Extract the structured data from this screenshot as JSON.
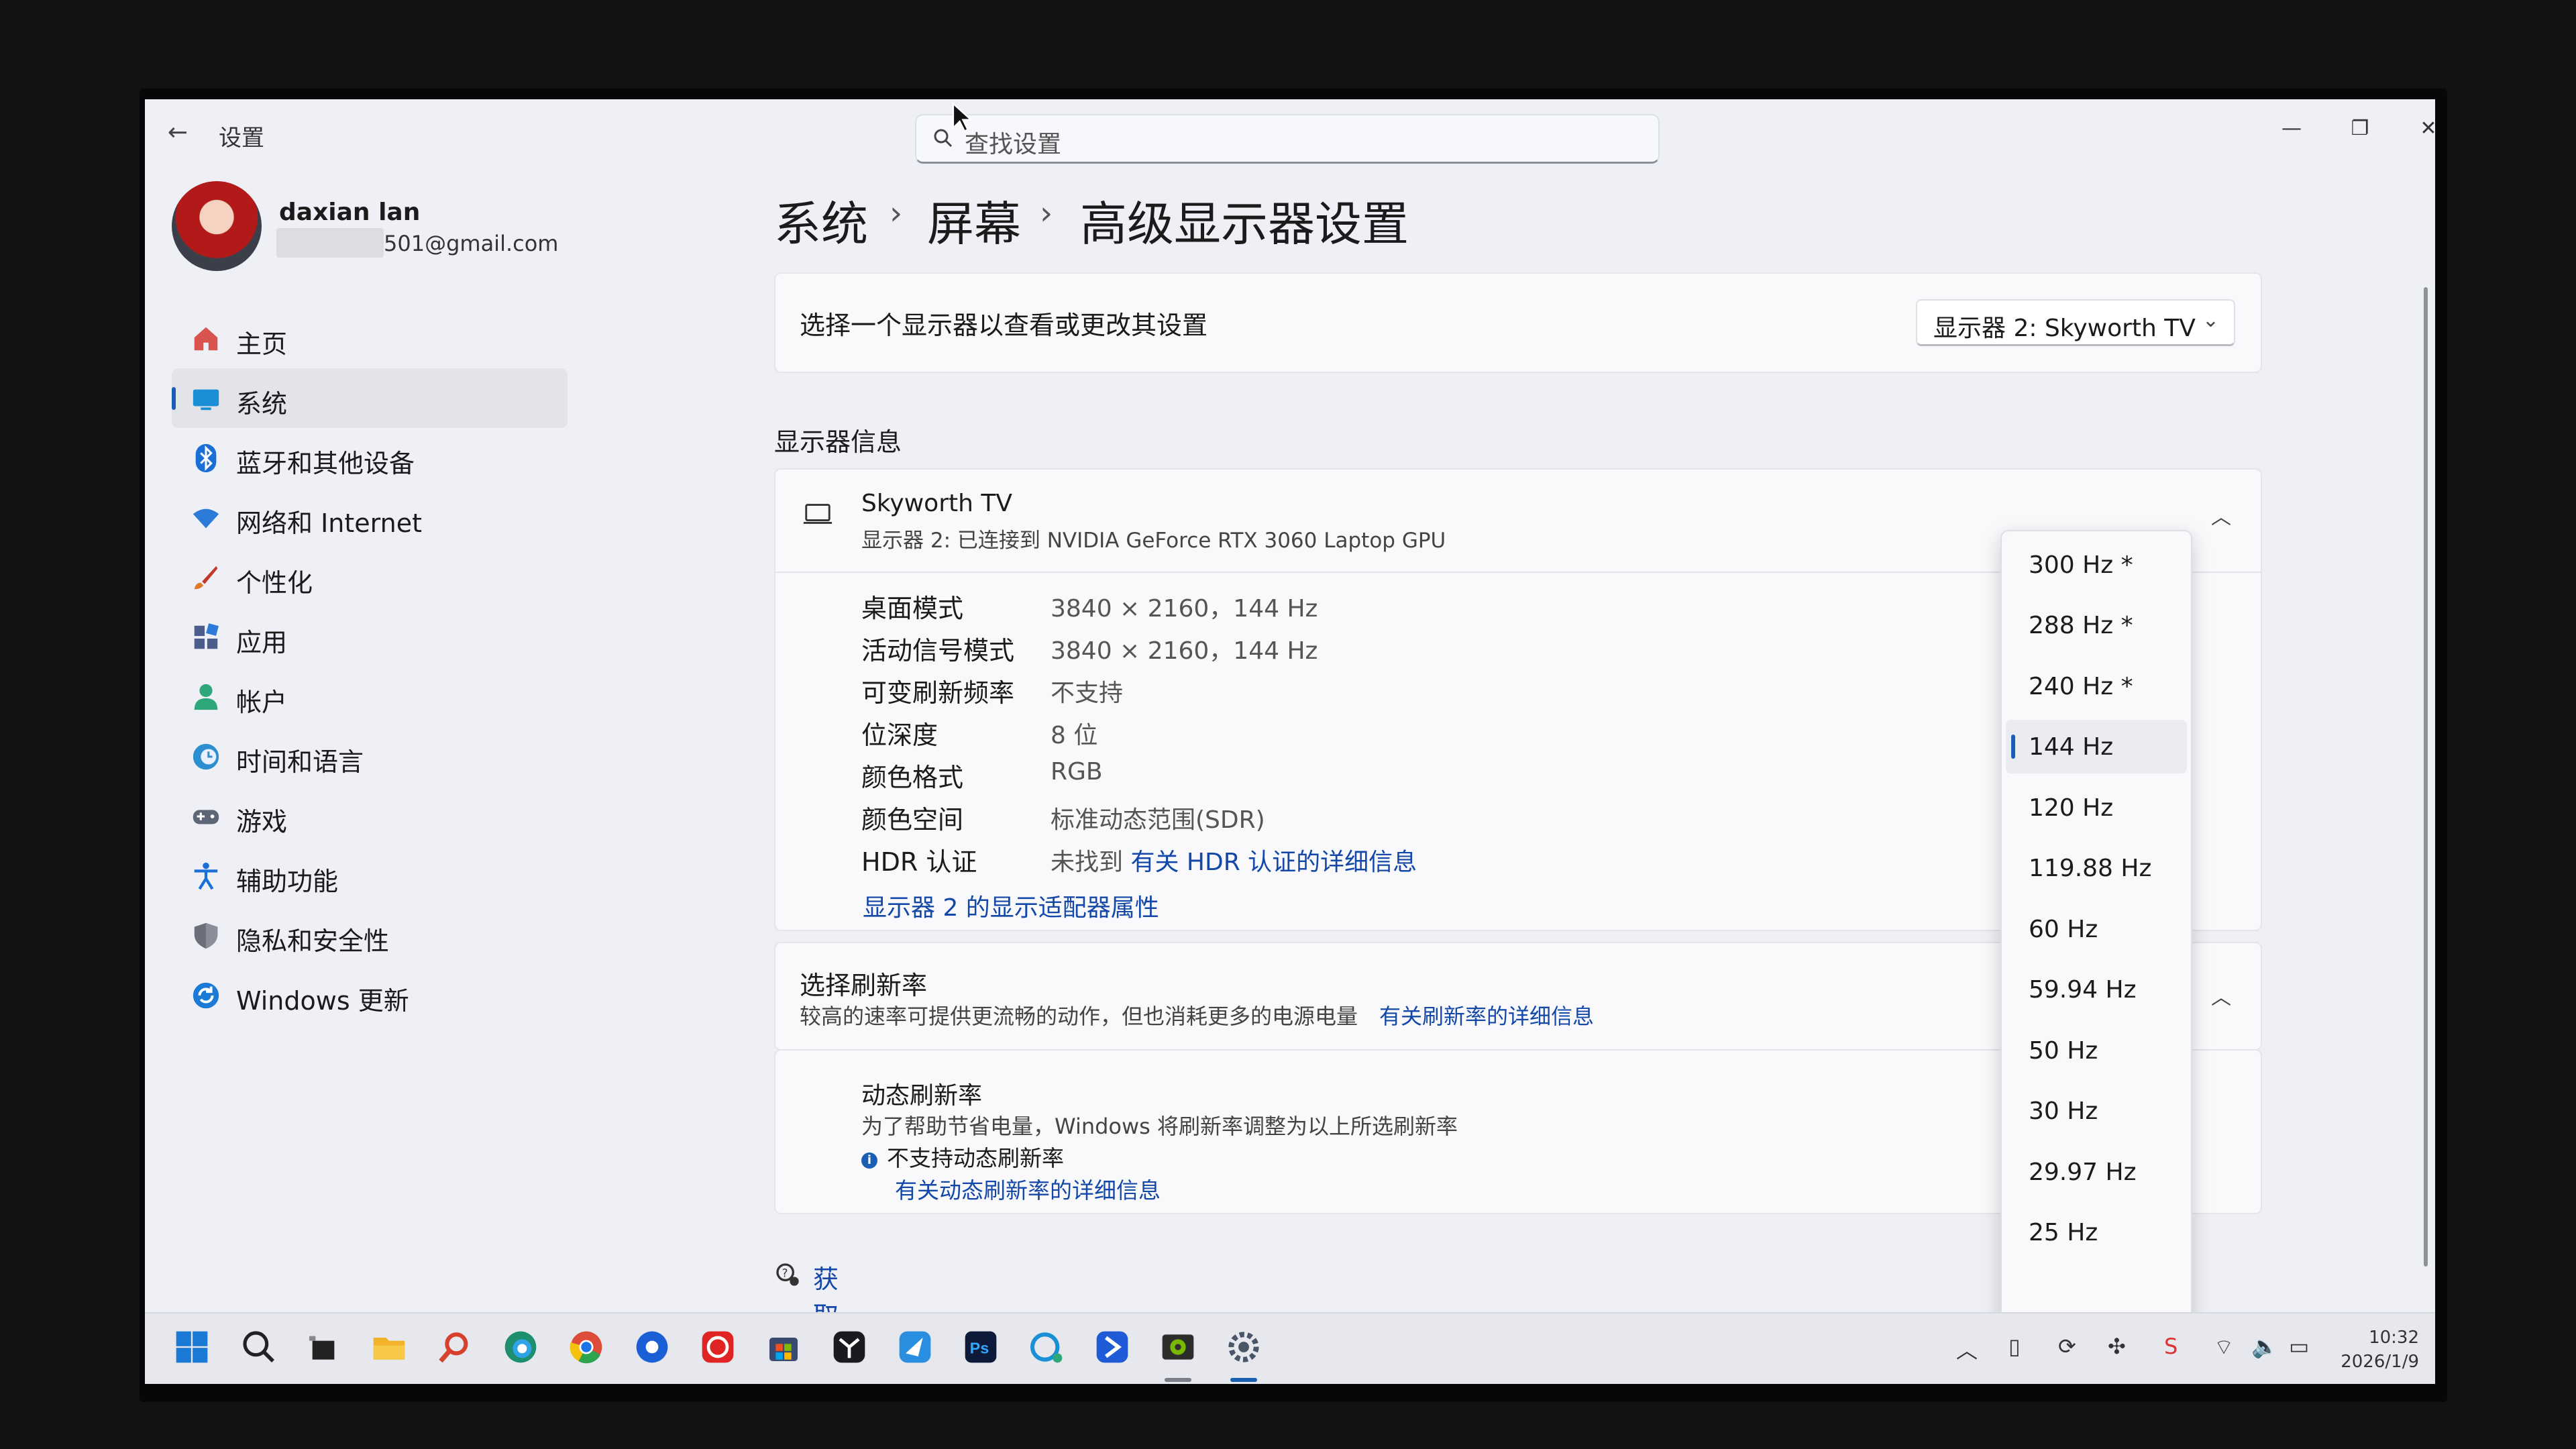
{
  "app": {
    "title": "设置",
    "back_icon": "back-arrow-icon"
  },
  "search": {
    "placeholder": "查找设置"
  },
  "window_controls": {
    "minimize": "—",
    "restore": "❐",
    "close": "✕"
  },
  "user": {
    "name": "daxian lan",
    "email_visible": "501@gmail.com"
  },
  "sidebar": {
    "items": [
      {
        "label": "主页",
        "icon": "home-icon",
        "color": "#d9534f"
      },
      {
        "label": "系统",
        "icon": "monitor-icon",
        "color": "#1a8fd6",
        "selected": true
      },
      {
        "label": "蓝牙和其他设备",
        "icon": "bluetooth-icon",
        "color": "#1a6fd6"
      },
      {
        "label": "网络和 Internet",
        "icon": "wifi-icon",
        "color": "#2c7bd9"
      },
      {
        "label": "个性化",
        "icon": "brush-icon",
        "color": "#e07a2a"
      },
      {
        "label": "应用",
        "icon": "apps-icon",
        "color": "#4a5d8c"
      },
      {
        "label": "帐户",
        "icon": "person-icon",
        "color": "#2ea77a"
      },
      {
        "label": "时间和语言",
        "icon": "globe-clock-icon",
        "color": "#2d8fd1"
      },
      {
        "label": "游戏",
        "icon": "gamepad-icon",
        "color": "#5c6677"
      },
      {
        "label": "辅助功能",
        "icon": "accessibility-icon",
        "color": "#1a6fd6"
      },
      {
        "label": "隐私和安全性",
        "icon": "shield-icon",
        "color": "#6b6f7a"
      },
      {
        "label": "Windows 更新",
        "icon": "update-icon",
        "color": "#1a7ad6"
      }
    ]
  },
  "breadcrumb": {
    "level1": "系统",
    "level2": "屏幕",
    "level3": "高级显示器设置",
    "separator": "›"
  },
  "display_select": {
    "label": "选择一个显示器以查看或更改其设置",
    "value": "显示器 2: Skyworth TV"
  },
  "display_info": {
    "heading": "显示器信息",
    "name": "Skyworth TV",
    "desc": "显示器 2: 已连接到 NVIDIA GeForce RTX 3060 Laptop GPU",
    "rows": [
      {
        "key": "桌面模式",
        "value": "3840 × 2160，144 Hz"
      },
      {
        "key": "活动信号模式",
        "value": "3840 × 2160，144 Hz"
      },
      {
        "key": "可变刷新频率",
        "value": "不支持"
      },
      {
        "key": "位深度",
        "value": "8 位"
      },
      {
        "key": "颜色格式",
        "value": "RGB"
      },
      {
        "key": "颜色空间",
        "value": "标准动态范围(SDR)"
      },
      {
        "key": "HDR 认证",
        "value": "未找到",
        "link": "有关 HDR 认证的详细信息"
      }
    ],
    "adapter_link": "显示器 2 的显示适配器属性"
  },
  "refresh_rate": {
    "title": "选择刷新率",
    "desc": "较高的速率可提供更流畅的动作，但也消耗更多的电源电量",
    "link": "有关刷新率的详细信息",
    "options": [
      "300 Hz *",
      "288 Hz *",
      "240 Hz *",
      "144 Hz",
      "120 Hz",
      "119.88 Hz",
      "60 Hz",
      "59.94 Hz",
      "50 Hz",
      "30 Hz",
      "29.97 Hz",
      "25 Hz"
    ],
    "selected": "144 Hz"
  },
  "dynamic_refresh": {
    "title": "动态刷新率",
    "desc": "为了帮助节省电量，Windows 将刷新率调整为以上所选刷新率",
    "note": "不支持动态刷新率",
    "link": "有关动态刷新率的详细信息"
  },
  "help": {
    "label": "获取帮助"
  },
  "taskbar": {
    "apps": [
      "start-icon",
      "search-icon",
      "task-view-icon",
      "file-explorer-icon",
      "search-app-icon",
      "edge-icon",
      "chrome-icon",
      "app-blue-icon",
      "app-red-icon",
      "store-icon",
      "app-dark-icon",
      "app-bird-icon",
      "photoshop-icon",
      "app-chat-icon",
      "app-blue2-icon",
      "nvidia-icon",
      "settings-icon"
    ],
    "time": "10:32",
    "date": "2026/1/9"
  }
}
